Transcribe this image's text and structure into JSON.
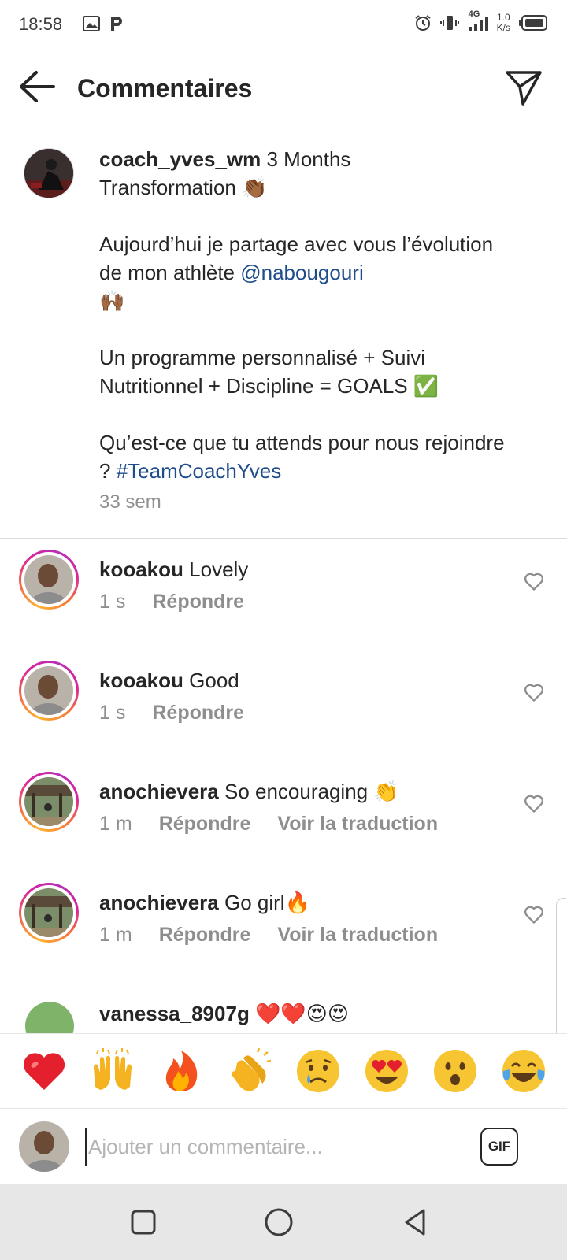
{
  "status_bar": {
    "time": "18:58",
    "network_label": "4G",
    "speed_value": "1.0",
    "speed_unit": "K/s",
    "icons": [
      "image-icon",
      "p-icon",
      "alarm-icon",
      "vibrate-icon",
      "signal-icon",
      "battery-icon"
    ]
  },
  "header": {
    "title": "Commentaires",
    "back_icon": "arrow-left-icon",
    "send_icon": "paper-plane-icon"
  },
  "caption": {
    "username": "coach_yves_wm",
    "line1_rest": " 3 Months",
    "line2": "Transformation 👏🏾",
    "para2_text": "Aujourd’hui je partage avec vous l’évolution de mon athlète ",
    "para2_mention": "@nabougouri",
    "para2_emoji": "🙌🏾",
    "para3": "Un programme personnalisé + Suivi Nutritionnel + Discipline = GOALS ✅",
    "para4_text": "Qu’est-ce que tu attends pour nous rejoindre ? ",
    "para4_hashtag": "#TeamCoachYves",
    "time": "33 sem"
  },
  "comments": [
    {
      "username": "kooakou",
      "text": " Lovely",
      "time": "1 s",
      "reply": "Répondre",
      "translate": ""
    },
    {
      "username": "kooakou",
      "text": " Good",
      "time": "1 s",
      "reply": "Répondre",
      "translate": ""
    },
    {
      "username": "anochievera",
      "text": " So encouraging 👏",
      "time": "1 m",
      "reply": "Répondre",
      "translate": "Voir la traduction"
    },
    {
      "username": "anochievera",
      "text": " Go girl🔥",
      "time": "1 m",
      "reply": "Répondre",
      "translate": "Voir la traduction"
    },
    {
      "username": "vanessa_8907g",
      "text": " ❤️❤️😍😍",
      "time": "",
      "reply": "",
      "translate": ""
    }
  ],
  "emoji_bar": [
    "❤️",
    "🙌",
    "🔥",
    "👏",
    "😢",
    "😍",
    "😮",
    "😂"
  ],
  "compose": {
    "placeholder": "Ajouter un commentaire...",
    "gif_label": "GIF"
  },
  "nav_bar": {
    "icons": [
      "recents-square-icon",
      "home-circle-icon",
      "back-triangle-icon"
    ]
  }
}
